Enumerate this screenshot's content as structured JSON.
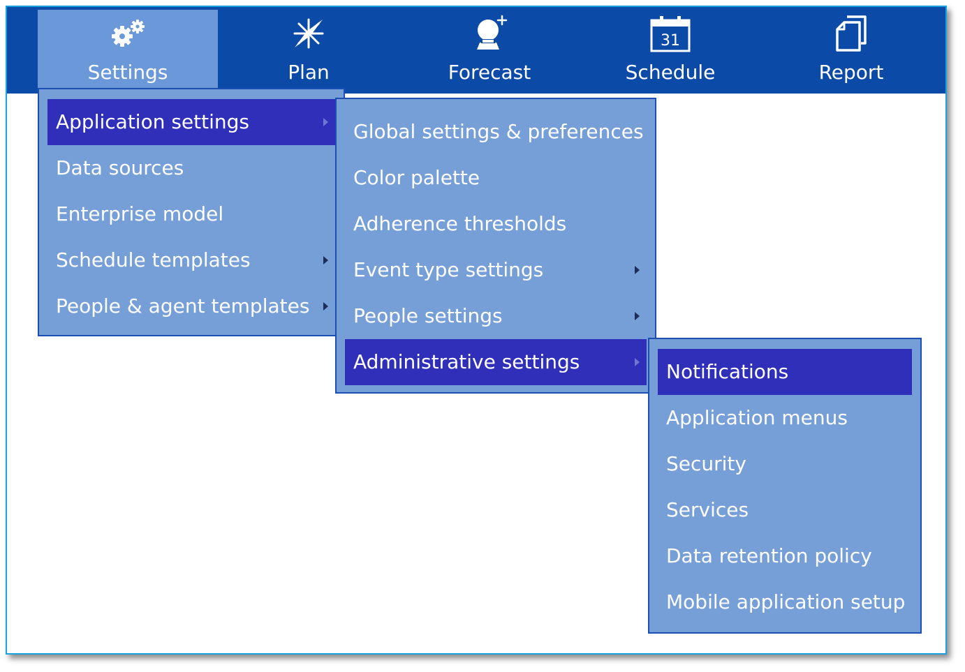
{
  "nav": [
    {
      "label": "Settings",
      "icon": "gears-icon",
      "active": true
    },
    {
      "label": "Plan",
      "icon": "compass-icon",
      "active": false
    },
    {
      "label": "Forecast",
      "icon": "crystal-ball-icon",
      "active": false
    },
    {
      "label": "Schedule",
      "icon": "calendar-icon",
      "calendar_day": "31",
      "active": false
    },
    {
      "label": "Report",
      "icon": "report-pages-icon",
      "active": false
    }
  ],
  "menu1": [
    {
      "label": "Application settings",
      "highlighted": true,
      "has_submenu": true
    },
    {
      "label": "Data sources",
      "highlighted": false,
      "has_submenu": false
    },
    {
      "label": "Enterprise model",
      "highlighted": false,
      "has_submenu": false
    },
    {
      "label": "Schedule templates",
      "highlighted": false,
      "has_submenu": true
    },
    {
      "label": "People & agent templates",
      "highlighted": false,
      "has_submenu": true
    }
  ],
  "menu2": [
    {
      "label": "Global settings & preferences",
      "highlighted": false,
      "has_submenu": false
    },
    {
      "label": "Color palette",
      "highlighted": false,
      "has_submenu": false
    },
    {
      "label": "Adherence thresholds",
      "highlighted": false,
      "has_submenu": false
    },
    {
      "label": "Event type settings",
      "highlighted": false,
      "has_submenu": true
    },
    {
      "label": "People settings",
      "highlighted": false,
      "has_submenu": true
    },
    {
      "label": "Administrative settings",
      "highlighted": true,
      "has_submenu": true
    }
  ],
  "menu3": [
    {
      "label": "Notifications",
      "highlighted": true,
      "has_submenu": false
    },
    {
      "label": "Application menus",
      "highlighted": false,
      "has_submenu": false
    },
    {
      "label": "Security",
      "highlighted": false,
      "has_submenu": false
    },
    {
      "label": "Services",
      "highlighted": false,
      "has_submenu": false
    },
    {
      "label": "Data retention policy",
      "highlighted": false,
      "has_submenu": false
    },
    {
      "label": "Mobile application setup",
      "highlighted": false,
      "has_submenu": false
    }
  ],
  "colors": {
    "topbar": "#0b4aa6",
    "active_tab": "#6b98d8",
    "menu_bg": "#769fd8",
    "menu_border": "#1b4fb4",
    "highlight": "#2f2fba",
    "frame_border": "#1aa2e0"
  }
}
